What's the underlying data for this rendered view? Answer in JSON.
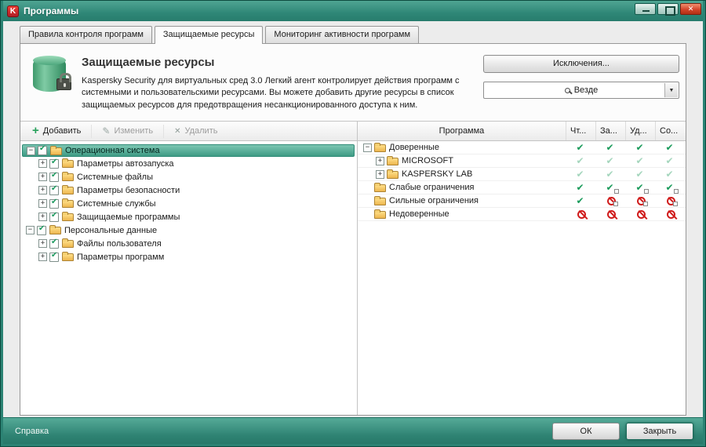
{
  "window": {
    "title": "Программы"
  },
  "tabs": [
    {
      "label": "Правила контроля программ",
      "active": false
    },
    {
      "label": "Защищаемые ресурсы",
      "active": true
    },
    {
      "label": "Мониторинг активности программ",
      "active": false
    }
  ],
  "header": {
    "title": "Защищаемые ресурсы",
    "description": "Kaspersky Security для виртуальных сред 3.0 Легкий агент контролирует действия программ с системными и пользовательскими ресурсами. Вы можете добавить другие ресурсы в список защищаемых ресурсов для предотвращения несанкционированного доступа к ним.",
    "exclusions_button_label": "Исключения...",
    "search": {
      "selected_value": "Везде"
    }
  },
  "toolbar": {
    "add_label": "Добавить",
    "edit_label": "Изменить",
    "delete_label": "Удалить"
  },
  "tree": {
    "rows": [
      {
        "label": "Операционная система",
        "level": 0,
        "expanded": true,
        "checked": true,
        "selected": true
      },
      {
        "label": "Параметры автозапуска",
        "level": 1,
        "expanded": false,
        "checked": true,
        "selected": false
      },
      {
        "label": "Системные файлы",
        "level": 1,
        "expanded": false,
        "checked": true,
        "selected": false
      },
      {
        "label": "Параметры безопасности",
        "level": 1,
        "expanded": false,
        "checked": true,
        "selected": false
      },
      {
        "label": "Системные службы",
        "level": 1,
        "expanded": false,
        "checked": true,
        "selected": false
      },
      {
        "label": "Защищаемые программы",
        "level": 1,
        "expanded": false,
        "checked": true,
        "selected": false
      },
      {
        "label": "Персональные данные",
        "level": 0,
        "expanded": true,
        "checked": true,
        "selected": false
      },
      {
        "label": "Файлы пользователя",
        "level": 1,
        "expanded": false,
        "checked": true,
        "selected": false
      },
      {
        "label": "Параметры программ",
        "level": 1,
        "expanded": false,
        "checked": true,
        "selected": false
      }
    ]
  },
  "table": {
    "columns": [
      "Программа",
      "Чт...",
      "За...",
      "Уд...",
      "Со..."
    ],
    "rows": [
      {
        "label": "Доверенные",
        "level": 0,
        "expander": "minus",
        "permissions": [
          "allow",
          "allow",
          "allow",
          "allow"
        ]
      },
      {
        "label": "MICROSOFT",
        "level": 1,
        "expander": "plus",
        "permissions": [
          "allow-inherited",
          "allow-inherited",
          "allow-inherited",
          "allow-inherited"
        ]
      },
      {
        "label": "KASPERSKY LAB",
        "level": 1,
        "expander": "plus",
        "permissions": [
          "allow-inherited",
          "allow-inherited",
          "allow-inherited",
          "allow-inherited"
        ]
      },
      {
        "label": "Слабые ограничения",
        "level": 0,
        "expander": "none",
        "permissions": [
          "allow",
          "allow-prompt",
          "allow-prompt",
          "allow-prompt"
        ]
      },
      {
        "label": "Сильные ограничения",
        "level": 0,
        "expander": "none",
        "permissions": [
          "allow",
          "block-prompt",
          "block-prompt",
          "block-prompt"
        ]
      },
      {
        "label": "Недоверенные",
        "level": 0,
        "expander": "none",
        "permissions": [
          "block",
          "block",
          "block",
          "block"
        ]
      }
    ]
  },
  "footer": {
    "help_label": "Справка",
    "ok_label": "ОК",
    "close_label": "Закрыть"
  },
  "colors": {
    "accent_teal": "#2c8374",
    "allow_green": "#189a5a",
    "block_red": "#d01b1b",
    "close_red": "#c23a22"
  }
}
